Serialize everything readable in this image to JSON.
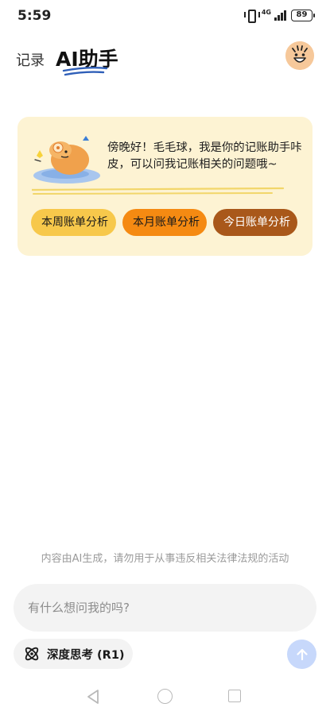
{
  "status_bar": {
    "time": "5:59",
    "network": "4G",
    "battery": "89",
    "icons": [
      "vibrate-icon",
      "signal-icon",
      "battery-icon"
    ]
  },
  "header": {
    "tab_record": "记录",
    "tab_ai": "AI助手",
    "active_tab": "AI助手",
    "accent_color": "#2f5fb8"
  },
  "greeting_card": {
    "message": "傍晚好！毛毛球，我是你的记账助手咔皮，可以问我记账相关的问题哦~",
    "background": "#fdf3d3",
    "quick_actions": [
      {
        "label": "本周账单分析",
        "color": "#f7c84b"
      },
      {
        "label": "本月账单分析",
        "color": "#f58a12"
      },
      {
        "label": "今日账单分析",
        "color": "#a9581a"
      }
    ]
  },
  "disclaimer": "内容由AI生成，请勿用于从事违反相关法律法规的活动",
  "input": {
    "placeholder": "有什么想问我的吗?",
    "value": ""
  },
  "deep_think": {
    "label": "深度思考 (R1)",
    "icon": "atom-icon"
  },
  "send_button": {
    "icon": "arrow-up-icon",
    "color": "#c7d8fb"
  },
  "nav_bar": {
    "icons": [
      "back-triangle-icon",
      "home-circle-icon",
      "recent-square-icon"
    ]
  }
}
